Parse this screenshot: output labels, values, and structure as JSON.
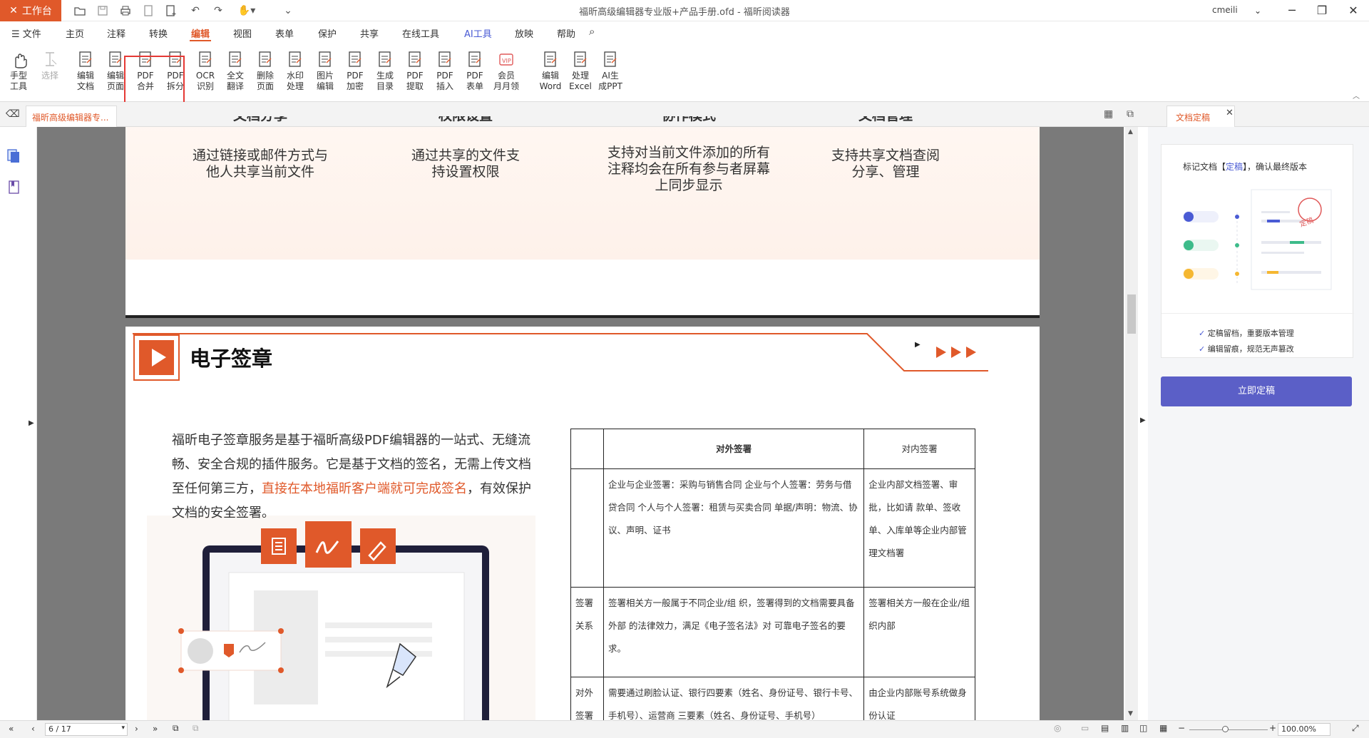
{
  "titlebar": {
    "workbench": "工作台",
    "title": "福昕高级编辑器专业版+产品手册.ofd - 福昕阅读器",
    "user": "cmeili"
  },
  "menu": {
    "file": "文件",
    "items": [
      "主页",
      "注释",
      "转换",
      "编辑",
      "视图",
      "表单",
      "保护",
      "共享",
      "在线工具",
      "AI工具",
      "放映",
      "帮助"
    ],
    "active": "编辑"
  },
  "ribbon": {
    "tools": [
      {
        "l1": "手型",
        "l2": "工具"
      },
      {
        "l1": "选择",
        "l2": ""
      },
      {
        "l1": "编辑",
        "l2": "文档"
      },
      {
        "l1": "编辑",
        "l2": "页面"
      },
      {
        "l1": "PDF",
        "l2": "合并"
      },
      {
        "l1": "PDF",
        "l2": "拆分"
      },
      {
        "l1": "OCR",
        "l2": "识别"
      },
      {
        "l1": "全文",
        "l2": "翻译"
      },
      {
        "l1": "删除",
        "l2": "页面"
      },
      {
        "l1": "水印",
        "l2": "处理"
      },
      {
        "l1": "图片",
        "l2": "编辑"
      },
      {
        "l1": "PDF",
        "l2": "加密"
      },
      {
        "l1": "生成",
        "l2": "目录"
      },
      {
        "l1": "PDF",
        "l2": "提取"
      },
      {
        "l1": "PDF",
        "l2": "插入"
      },
      {
        "l1": "PDF",
        "l2": "表单"
      },
      {
        "l1": "会员",
        "l2": "月月领"
      },
      {
        "l1": "编辑",
        "l2": "Word"
      },
      {
        "l1": "处理",
        "l2": "Excel"
      },
      {
        "l1": "AI生",
        "l2": "成PPT"
      }
    ]
  },
  "tabs": {
    "doc_tab": "福昕高级编辑器专...",
    "side_tab": "文档定稿"
  },
  "page_top": {
    "cols": [
      {
        "title": "文档分享",
        "desc": [
          "通过链接或邮件方式与",
          "他人共享当前文件"
        ]
      },
      {
        "title": "权限设置",
        "desc": [
          "通过共享的文件支",
          "持设置权限"
        ]
      },
      {
        "title": "协作模式",
        "desc": [
          "支持对当前文件添加的所有",
          "注释均会在所有参与者屏幕",
          "上同步显示"
        ]
      },
      {
        "title": "文档管理",
        "desc": [
          "支持共享文档查阅",
          "分享、管理"
        ]
      }
    ]
  },
  "section": {
    "title": "电子签章",
    "para_a": "福昕电子签章服务是基于福昕高级PDF编辑器的一站式、无缝流畅、安全合规的插件服务。它是基于文档的签名，无需上传文档至任何第三方，",
    "para_hl": "直接在本地福昕客户端就可完成签名",
    "para_b": "，有效保护文档的安全签署。"
  },
  "table": {
    "headers": [
      "",
      "对外签署",
      "对内签署"
    ],
    "rows": [
      {
        "label": "",
        "ext": "企业与企业签署：采购与销售合同 企业与个人签署：劳务与借贷合同 个人与个人签署：租赁与买卖合同 单据/声明：物流、协议、声明、证书",
        "int": "企业内部文档签署、审批，比如请 款单、签收单、入库单等企业内部管理文档署"
      },
      {
        "label": "签署关系",
        "ext": "签署相关方一般属于不同企业/组 织，签署得到的文档需要具备外部 的法律效力，满足《电子签名法》对 可靠电子签名的要求。",
        "int": "签署相关方一般在企业/组织内部"
      },
      {
        "label": "对外签署",
        "ext": "需要通过刷脸认证、银行四要素（姓名、身份证号、银行卡号、手机号）、运营商 三要素（姓名、身份证号、手机号）",
        "int": "由企业内部账号系统做身份认证"
      }
    ]
  },
  "panel": {
    "intro_a": "标记文档【",
    "intro_link": "定稿",
    "intro_b": "】，确认最终版本",
    "stamp": "定稿",
    "bullets": [
      "定稿留档，重要版本管理",
      "编辑留痕，规范无声篡改"
    ],
    "button": "立即定稿"
  },
  "status": {
    "page": "6 / 17",
    "zoom": "100.00%"
  },
  "colors": {
    "brand": "#e0592a",
    "accent_button": "#5b5fc7",
    "annotation": "#e53935"
  }
}
